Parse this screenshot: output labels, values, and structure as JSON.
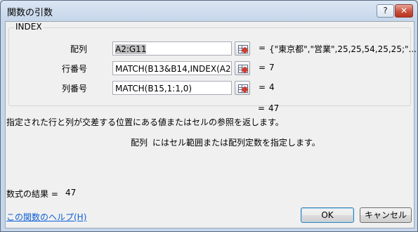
{
  "window": {
    "title": "関数の引数",
    "help_label": "?",
    "close_label": "✕"
  },
  "function": {
    "name": "INDEX",
    "args": [
      {
        "label": "配列",
        "value": "A2:G11",
        "result": "{\"東京都\",\"営業\",25,25,54,25,25;\"..."
      },
      {
        "label": "行番号",
        "value": "MATCH(B13&B14,INDEX(A2:",
        "result": "7"
      },
      {
        "label": "列番号",
        "value": "MATCH(B15,1:1,0)",
        "result": "4"
      }
    ],
    "equals": "=",
    "result_value": "47"
  },
  "description": "指定された行と列が交差する位置にある値またはセルの参照を返します。",
  "arg_help": {
    "name": "配列",
    "text": "にはセル範囲または配列定数を指定します。"
  },
  "formula_result": {
    "label": "数式の結果 =",
    "value": "47"
  },
  "footer": {
    "help_link": "この関数のヘルプ(H)",
    "ok_label": "OK",
    "cancel_label": "キャンセル"
  },
  "icons": {
    "ref": "range-select-icon"
  }
}
